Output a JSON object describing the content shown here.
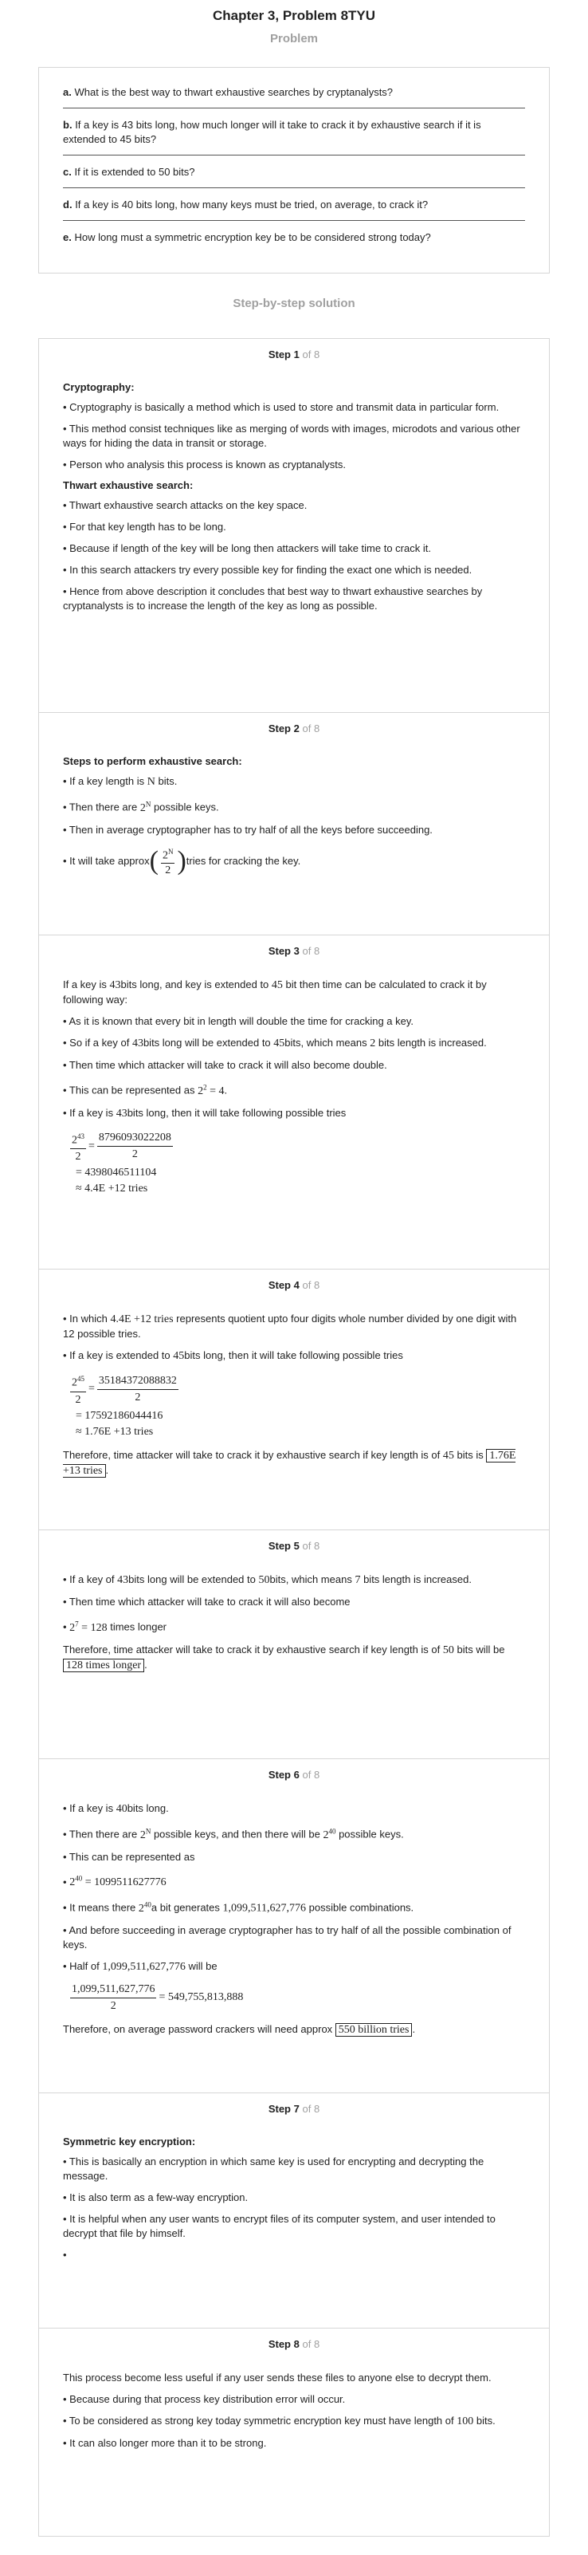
{
  "page": {
    "title": "Chapter 3, Problem 8TYU",
    "problem_heading": "Problem",
    "solution_heading": "Step-by-step solution"
  },
  "problem": {
    "questions": [
      {
        "letter": "a.",
        "text": "What is the best way to thwart exhaustive searches by cryptanalysts?"
      },
      {
        "letter": "b.",
        "text": "If a key is 43 bits long, how much longer will it take to crack it by exhaustive search if it is extended to 45 bits?"
      },
      {
        "letter": "c.",
        "text": "If it is extended to 50 bits?"
      },
      {
        "letter": "d.",
        "text": "If a key is 40 bits long, how many keys must be tried, on average, to crack it?"
      },
      {
        "letter": "e.",
        "text": "How long must a symmetric encryption key be to be considered strong today?"
      }
    ]
  },
  "steps": {
    "label": "Step",
    "of": "of 8",
    "s1": {
      "num": "1",
      "h1": "Cryptography:",
      "p1": "• Cryptography is basically a method which is used to store and transmit data in particular form.",
      "p2": "• This method consist techniques like as merging of words with images, microdots and various other ways for hiding the data in transit or storage.",
      "p3": "• Person who analysis this process is known as cryptanalysts.",
      "h2": "Thwart exhaustive search:",
      "p4": "• Thwart exhaustive search attacks on the key space.",
      "p5": "• For that key length has to be long.",
      "p6": "• Because if length of the key will be long then attackers will take time to crack it.",
      "p7": "• In this search attackers try every possible key for finding the exact one which is needed.",
      "p8": "• Hence from above description it concludes that best way to thwart exhaustive searches by cryptanalysts is to increase the length of the key as long as possible."
    },
    "s2": {
      "num": "2",
      "h1": "Steps to perform exhaustive search:",
      "p1a": "• If a key length is",
      "p1m": "N",
      "p1b": "bits.",
      "p2a": "• Then there are",
      "p2m": "2",
      "p2sup": "N",
      "p2b": "possible keys.",
      "p3": "• Then in average cryptographer has to try half of all the keys before succeeding.",
      "p4a": "• It will take approx",
      "p4num": "2",
      "p4numsup": "N",
      "p4den": "2",
      "p4b": "tries for cracking the key."
    },
    "s3": {
      "num": "3",
      "p1a": "If a key is",
      "p1m1": "43",
      "p1b": "bits long, and key is extended to",
      "p1m2": "45",
      "p1c": "bit then time can be calculated to crack it by following way:",
      "p2": "• As it is known that every bit in length will double the time for cracking a key.",
      "p3a": "• So if a key of",
      "p3m1": "43",
      "p3b": "bits long will be extended to",
      "p3m2": "45",
      "p3c": "bits, which means",
      "p3m3": "2",
      "p3d": "bits length is increased.",
      "p4": "• Then time which attacker will take to crack it will also become double.",
      "p5a": "• This can be represented as",
      "p5m": "2",
      "p5sup": "2",
      "p5m2": "= 4",
      "p5b": ".",
      "p6a": "• If a key is",
      "p6m": "43",
      "p6b": "bits long, then it will take following possible tries",
      "e_num": "2",
      "e_numsup": "43",
      "e_den": "2",
      "e_rnum": "8796093022208",
      "e_rden": "2",
      "e2": "= 4398046511104",
      "e3": "≈ 4.4E +12 tries"
    },
    "s4": {
      "num": "4",
      "p1a": "• In which",
      "p1m": "4.4E +12 tries",
      "p1b": "represents quotient upto four digits whole number divided by one digit with 12 possible tries.",
      "p2a": "• If a key is extended to",
      "p2m": "45",
      "p2b": "bits long, then it will take following possible tries",
      "e_num": "2",
      "e_numsup": "45",
      "e_den": "2",
      "e_rnum": "35184372088832",
      "e_rden": "2",
      "e2": "= 17592186044416",
      "e3": "≈ 1.76E +13 tries",
      "p3a": "Therefore, time attacker will take to crack it by exhaustive search if key length is of",
      "p3m": "45",
      "p3b": "bits is",
      "p3box": "1.76E +13 tries",
      "p3c": "."
    },
    "s5": {
      "num": "5",
      "p1a": "• If a key of",
      "p1m1": "43",
      "p1b": "bits long will be extended to",
      "p1m2": "50",
      "p1c": "bits, which means",
      "p1m3": "7",
      "p1d": "bits length is increased.",
      "p2": "• Then time which attacker will take to crack it will also become",
      "p3m": "2",
      "p3sup": "7",
      "p3m2": "= 128",
      "p3b": "times longer",
      "p4a": "Therefore, time attacker will take to crack it by exhaustive search if key length is of",
      "p4m": "50",
      "p4b": "bits will be",
      "p4box": "128 times longer",
      "p4c": "."
    },
    "s6": {
      "num": "6",
      "p1a": "• If a key is",
      "p1m": "40",
      "p1b": "bits long.",
      "p2a": "• Then there are",
      "p2m1": "2",
      "p2sup1": "N",
      "p2b": "possible keys, and then there will be",
      "p2m2": "2",
      "p2sup2": "40",
      "p2c": "possible keys.",
      "p3": "• This can be represented as",
      "p4a": "•",
      "p4m": "2",
      "p4sup": "40",
      "p4m2": "= 1099511627776",
      "p5a": "• It means there",
      "p5m": "2",
      "p5sup": "40",
      "p5b": "a bit generates",
      "p5m2": "1,099,511,627,776",
      "p5c": "possible combinations.",
      "p6": "• And before succeeding in average cryptographer has to try half of all the possible combination of keys.",
      "p7a": "• Half of",
      "p7m": "1,099,511,627,776",
      "p7b": "will be",
      "e_num": "1,099,511,627,776",
      "e_den": "2",
      "e_res": "= 549,755,813,888",
      "p8a": "Therefore, on average password crackers will need approx",
      "p8box": "550 billion tries",
      "p8b": "."
    },
    "s7": {
      "num": "7",
      "h1": "Symmetric key encryption:",
      "p1": "• This is basically an encryption in which same key is used for encrypting and decrypting the message.",
      "p2": "• It is also term as a few-way encryption.",
      "p3": "• It is helpful when any user wants to encrypt files of its computer system, and user intended to decrypt that file by himself.",
      "p4": "•"
    },
    "s8": {
      "num": "8",
      "p1": "This process become less useful if any user sends these files to anyone else to decrypt them.",
      "p2": "• Because during that process key distribution error will occur.",
      "p3a": "• To be considered as strong key today symmetric encryption key must have length of",
      "p3m": "100",
      "p3b": "bits.",
      "p4": "• It can also longer more than it to be strong."
    }
  }
}
